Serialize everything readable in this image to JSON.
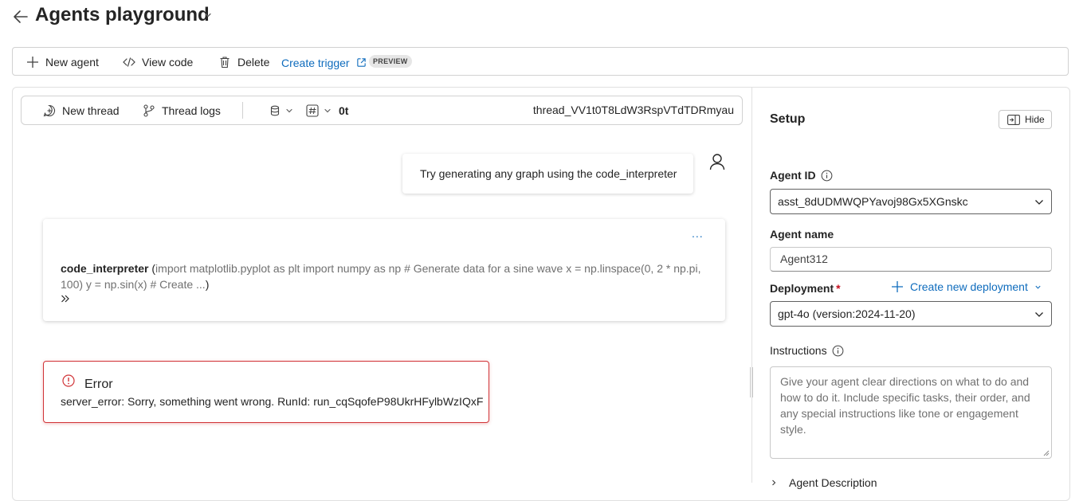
{
  "header": {
    "title": "Agents playground"
  },
  "toolbar": {
    "new_agent": "New agent",
    "view_code": "View code",
    "delete": "Delete",
    "create_trigger": "Create trigger",
    "preview_badge": "PREVIEW"
  },
  "thread_bar": {
    "new_thread": "New thread",
    "thread_logs": "Thread logs",
    "token_count": "0t",
    "thread_id": "thread_VV1t0T8LdW3RspVTdTDRmyau"
  },
  "chat": {
    "user_message": "Try generating any graph using the code_interpreter",
    "tool_call": {
      "more": "...",
      "name": "code_interpreter",
      "open_paren": " (",
      "code_preview": "import matplotlib.pyplot as plt import numpy as np # Generate data for a sine wave x = np.linspace(0, 2 * np.pi, 100) y = np.sin(x) # Create ...",
      "close_paren": ")"
    },
    "error": {
      "title": "Error",
      "message": "server_error: Sorry, something went wrong. RunId: run_cqSqofeP98UkrHFylbWzIQxF"
    }
  },
  "setup": {
    "title": "Setup",
    "hide_label": "Hide",
    "agent_id_label": "Agent ID",
    "agent_id_value": "asst_8dUDMWQPYavoj98Gx5XGnskc",
    "agent_name_label": "Agent name",
    "agent_name_value": "Agent312",
    "deployment_label": "Deployment",
    "required_mark": "*",
    "create_deployment": "Create new deployment",
    "deployment_value": "gpt-4o (version:2024-11-20)",
    "instructions_label": "Instructions",
    "instructions_placeholder": "Give your agent clear directions on what to do and how to do it. Include specific tasks, their order, and any special instructions like tone or engagement style.",
    "next_section": "Agent Description"
  },
  "colors": {
    "accent": "#0f6cbd",
    "error": "#d13438",
    "required": "#c50f1f"
  },
  "icons": {
    "back": "arrow-left-icon",
    "add": "plus-icon",
    "code": "code-icon",
    "delete": "trash-icon",
    "external": "open-external-icon",
    "chat_add": "chat-add-icon",
    "branch": "branch-icon",
    "database": "database-icon",
    "hash": "hash-icon",
    "person": "person-icon",
    "error": "error-circle-icon",
    "info": "info-icon",
    "panel": "panel-icon"
  }
}
